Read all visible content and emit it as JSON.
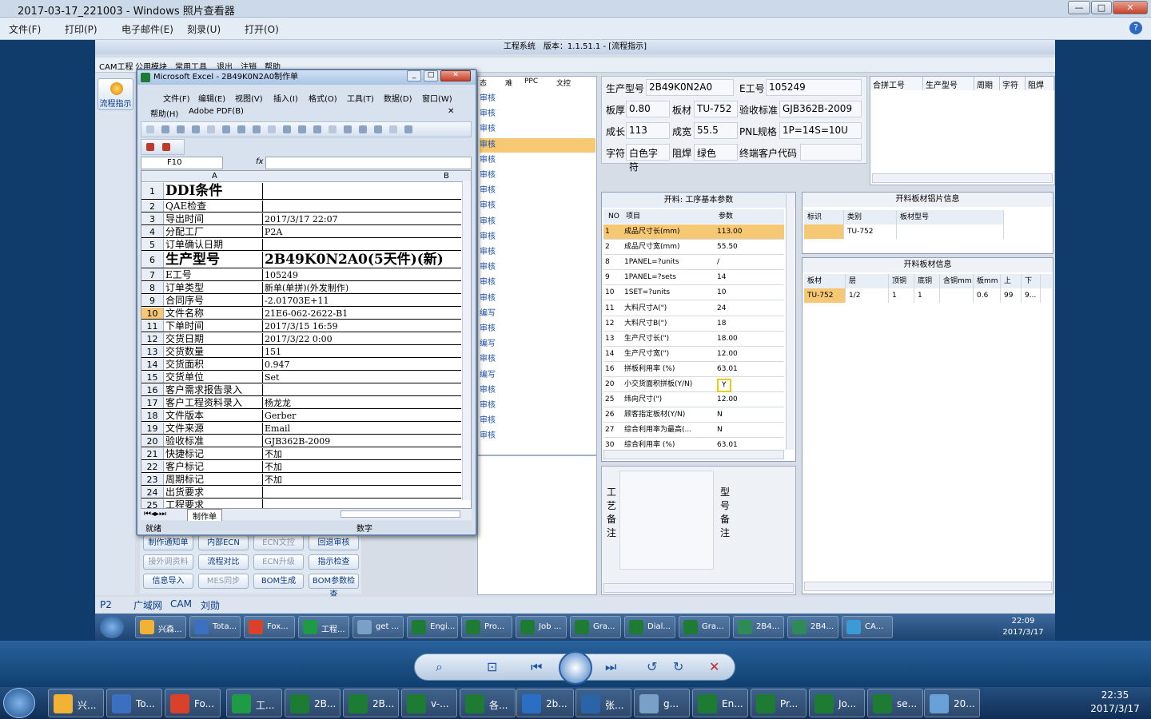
{
  "viewer": {
    "title": "2017-03-17_221003 - Windows 照片查看器",
    "menu": [
      "文件(F)",
      "打印(P)",
      "电子邮件(E)",
      "刻录(U)",
      "打开(O)"
    ],
    "min": "—",
    "max": "□",
    "close": "✕"
  },
  "app": {
    "title": "工程系统　版本：1.1.51.1 - [流程指示]",
    "menu": [
      "CAM工程",
      "公用模块",
      "常用工具",
      "退出",
      "注销",
      "帮助"
    ],
    "flow_btn": "流程指示"
  },
  "excel": {
    "title": "Microsoft Excel - 2B49K0N2A0制作单",
    "menu1": [
      "文件(F)",
      "编辑(E)",
      "视图(V)",
      "插入(I)",
      "格式(O)",
      "工具(T)",
      "数据(D)",
      "窗口(W)"
    ],
    "menu2": [
      "帮助(H)",
      "Adobe PDF(B)"
    ],
    "namebox": "F10",
    "col_a": "A",
    "col_b": "B",
    "rows": [
      {
        "n": "1",
        "a": "DDI条件",
        "b": ""
      },
      {
        "n": "2",
        "a": "QAE检查",
        "b": ""
      },
      {
        "n": "3",
        "a": "导出时间",
        "b": "2017/3/17 22:07"
      },
      {
        "n": "4",
        "a": "分配工厂",
        "b": "P2A"
      },
      {
        "n": "5",
        "a": "订单确认日期",
        "b": ""
      },
      {
        "n": "6",
        "a": "生产型号",
        "b": "2B49K0N2A0(5天件)(新)"
      },
      {
        "n": "7",
        "a": "E工号",
        "b": "105249"
      },
      {
        "n": "8",
        "a": "订单类型",
        "b": "新单(单拼)(外发制作)"
      },
      {
        "n": "9",
        "a": "合同序号",
        "b": "-2.01703E+11"
      },
      {
        "n": "10",
        "a": "文件名称",
        "b": "21E6-062-2622-B1"
      },
      {
        "n": "11",
        "a": "下单时间",
        "b": "2017/3/15 16:59"
      },
      {
        "n": "12",
        "a": "交货日期",
        "b": "2017/3/22 0:00"
      },
      {
        "n": "13",
        "a": "交货数量",
        "b": "151"
      },
      {
        "n": "14",
        "a": "交货面积",
        "b": "0.947"
      },
      {
        "n": "15",
        "a": "交货单位",
        "b": "Set"
      },
      {
        "n": "16",
        "a": "客户需求报告录入",
        "b": ""
      },
      {
        "n": "17",
        "a": "客户工程资料录入",
        "b": "杨龙龙"
      },
      {
        "n": "18",
        "a": "文件版本",
        "b": "Gerber"
      },
      {
        "n": "19",
        "a": "文件来源",
        "b": "Email"
      },
      {
        "n": "20",
        "a": "验收标准",
        "b": "GJB362B-2009"
      },
      {
        "n": "21",
        "a": "快捷标记",
        "b": "不加"
      },
      {
        "n": "22",
        "a": "客户标记",
        "b": "不加"
      },
      {
        "n": "23",
        "a": "周期标记",
        "b": "不加"
      },
      {
        "n": "24",
        "a": "出货要求",
        "b": ""
      },
      {
        "n": "25",
        "a": "工程要求",
        "b": ""
      }
    ],
    "sheet_tab": "制作单",
    "status_left": "就绪",
    "status_mid": "数字"
  },
  "midlist": {
    "headers": [
      "态",
      "难",
      "PPC",
      "文控"
    ],
    "items": [
      "审核",
      "审核",
      "审核",
      "审核",
      "审核",
      "审核",
      "审核",
      "审核",
      "审核",
      "审核",
      "审核",
      "审核",
      "审核",
      "审核",
      "编写",
      "审核",
      "编写",
      "审核",
      "编写",
      "审核",
      "审核",
      "审核",
      "审核"
    ]
  },
  "buttons": [
    {
      "label": "制作通知单",
      "enabled": true
    },
    {
      "label": "内部ECN",
      "enabled": true
    },
    {
      "label": "ECN文控",
      "enabled": false
    },
    {
      "label": "回退审核",
      "enabled": true
    },
    {
      "label": "接外调资料",
      "enabled": false
    },
    {
      "label": "流程对比",
      "enabled": true
    },
    {
      "label": "ECN升级",
      "enabled": false
    },
    {
      "label": "指示检查",
      "enabled": true
    },
    {
      "label": "信息导入",
      "enabled": true
    },
    {
      "label": "MES同步",
      "enabled": false
    },
    {
      "label": "BOM生成",
      "enabled": true
    },
    {
      "label": "BOM参数检查",
      "enabled": true
    }
  ],
  "info": {
    "model_label": "生产型号",
    "model": "2B49K0N2A0",
    "e_label": "E工号",
    "e": "105249",
    "thick_label": "板厚",
    "thick": "0.80",
    "mat_label": "板材",
    "mat": "TU-752",
    "std_label": "验收标准",
    "std": "GJB362B-2009",
    "len_label": "成长",
    "len": "113",
    "wid_label": "成宽",
    "wid": "55.5",
    "pnl_label": "PNL规格",
    "pnl": "1P=14S=10U",
    "char_label": "字符",
    "char": "白色字符",
    "mask_label": "阻焊",
    "mask": "绿色",
    "cust_label": "终端客户代码",
    "cust": ""
  },
  "combine_headers": [
    "合拼工号",
    "生产型号",
    "周期",
    "字符",
    "阻焊"
  ],
  "params": {
    "title": "开料: 工序基本参数",
    "h_no": "NO",
    "h_item": "项目",
    "h_val": "参数",
    "rows": [
      {
        "no": "1",
        "item": "成品尺寸长(mm)",
        "val": "113.00"
      },
      {
        "no": "2",
        "item": "成品尺寸宽(mm)",
        "val": "55.50"
      },
      {
        "no": "8",
        "item": "1PANEL=?units",
        "val": "/"
      },
      {
        "no": "9",
        "item": "1PANEL=?sets",
        "val": "14"
      },
      {
        "no": "10",
        "item": "1SET=?units",
        "val": "10"
      },
      {
        "no": "11",
        "item": "大料尺寸A(\")",
        "val": "24"
      },
      {
        "no": "12",
        "item": "大料尺寸B(\")",
        "val": "18"
      },
      {
        "no": "13",
        "item": "生产尺寸长(\")",
        "val": "18.00"
      },
      {
        "no": "14",
        "item": "生产尺寸宽(\")",
        "val": "12.00"
      },
      {
        "no": "16",
        "item": "拼板利用率 (%)",
        "val": "63.01"
      },
      {
        "no": "20",
        "item": "小交货面积拼板(Y/N)",
        "val": "Y"
      },
      {
        "no": "25",
        "item": "纬向尺寸(\")",
        "val": "12.00"
      },
      {
        "no": "26",
        "item": "顾客指定板材(Y/N)",
        "val": "N"
      },
      {
        "no": "27",
        "item": "综合利用率为最高(...",
        "val": "N"
      },
      {
        "no": "30",
        "item": "综合利用率 (%)",
        "val": "63.01"
      }
    ]
  },
  "notes": {
    "left": "工艺备注",
    "right": "型号备注"
  },
  "lamp": {
    "title": "开料板材铝片信息",
    "headers": [
      "标识",
      "类别",
      "板材型号"
    ],
    "row": [
      "",
      "TU-752",
      ""
    ]
  },
  "sheet": {
    "title": "开料板材信息",
    "headers": [
      "板材",
      "层",
      "顶铜",
      "底铜",
      "含铜mm",
      "板mm",
      "上",
      "下"
    ],
    "row": [
      "TU-752",
      "1/2",
      "1",
      "1",
      "",
      "0.6",
      "99",
      "9..."
    ]
  },
  "status": {
    "p": "P2",
    "a": "广域网",
    "b": "CAM",
    "c": "刘勋"
  },
  "inner_tasks": [
    "兴森...",
    "Tota...",
    "Fox...",
    "工程...",
    "get ...",
    "Engi...",
    "Pro...",
    "Job ...",
    "Gra...",
    "Dial...",
    "Gra...",
    "2B4...",
    "2B4...",
    "CA..."
  ],
  "inner_clock": {
    "time": "22:09",
    "date": "2017/3/17"
  },
  "tasks": [
    "兴...",
    "To...",
    "Fo...",
    "工...",
    "2B...",
    "2B...",
    "v-...",
    "各...",
    "2b...",
    "张...",
    "g...",
    "En...",
    "Pr...",
    "Jo...",
    "se...",
    "20..."
  ],
  "clock": {
    "time": "22:35",
    "date": "2017/3/17"
  },
  "colors": {
    "accent": "#1f56a0",
    "highlight": "#f7c873",
    "yellowbox": "#e6d200"
  }
}
